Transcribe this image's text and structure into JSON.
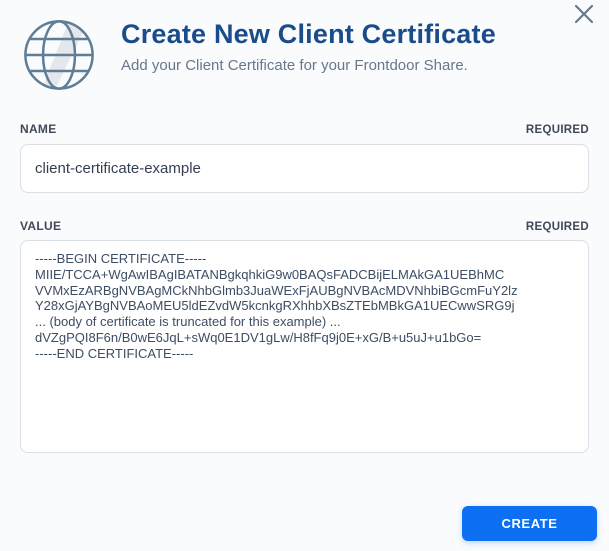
{
  "modal": {
    "title": "Create New Client Certificate",
    "subtitle": "Add your Client Certificate for your Frontdoor Share."
  },
  "icons": {
    "globe": "globe-icon",
    "close": "close-icon"
  },
  "fields": {
    "name": {
      "label": "NAME",
      "required_badge": "REQUIRED",
      "value": "client-certificate-example"
    },
    "value": {
      "label": "VALUE",
      "required_badge": "REQUIRED",
      "value": "-----BEGIN CERTIFICATE-----\nMIIE/TCCA+WgAwIBAgIBATANBgkqhkiG9w0BAQsFADCBijELMAkGA1UEBhMC\nVVMxEzARBgNVBAgMCkNhbGlmb3JuaWExFjAUBgNVBAcMDVNhbiBGcmFuY2lz\nY28xGjAYBgNVBAoMEU5ldEZvdW5kcnkgRXhhbXBsZTEbMBkGA1UECwwSRG9j\n... (body of certificate is truncated for this example) ...\ndVZgPQI8F6n/B0wE6JqL+sWq0E1DV1gLw/H8fFq9j0E+xG/B+u5uJ+u1bGo=\n-----END CERTIFICATE-----"
    }
  },
  "actions": {
    "create_label": "CREATE"
  },
  "colors": {
    "title": "#1a4c8b",
    "subtitle": "#67788c",
    "accent_button": "#0d70f2",
    "field_border": "#dadfe6",
    "background": "#fafbfc",
    "icon_stroke": "#5f7d96"
  }
}
